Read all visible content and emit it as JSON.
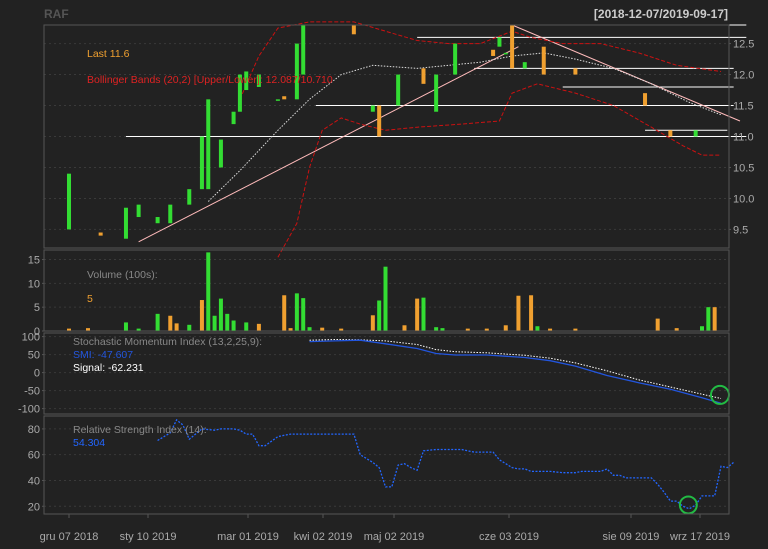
{
  "header": {
    "symbol": "RAF",
    "date_range": "[2018-12-07/2019-09-17]"
  },
  "colors": {
    "background": "#222222",
    "panel_border": "#555555",
    "grid": "#3a3a3a",
    "axis_text": "#aaaaaa",
    "up_candle": "#33dd33",
    "down_candle": "#f0a030",
    "bbands": "#cc1111",
    "bbands_mid": "#dddddd",
    "trendline": "#ffbbbb",
    "hline": "#ffffff",
    "smi": "#2255dd",
    "signal": "#ffffff",
    "rsi": "#2266ff",
    "circle": "#22bb44",
    "last_label": "#f0a030",
    "bb_label": "#dd2222",
    "volume_bar_label": "#f0a030"
  },
  "chart_data": [
    {
      "type": "candlestick",
      "panel": "price",
      "labels": {
        "last": "Last 11.6",
        "bollinger": "Bollinger Bands (20,2) [Upper/Lower]: 12.087/10.710"
      },
      "ylim": [
        9.2,
        12.8
      ],
      "yticks": [
        "9.5",
        "10.0",
        "10.5",
        "11.0",
        "11.5",
        "12.0",
        "12.5"
      ],
      "xticks": [
        "gru 07 2018",
        "sty 10 2019",
        "mar 01 2019",
        "kwi 02 2019",
        "maj 02 2019",
        "cze 03 2019",
        "sie 09 2019",
        "wrz 17 2019"
      ],
      "n": 100,
      "candles": [
        {
          "i": 0,
          "o": 9.5,
          "c": 10.4
        },
        {
          "i": 5,
          "o": 9.45,
          "c": 9.4
        },
        {
          "i": 9,
          "o": 9.35,
          "c": 9.85
        },
        {
          "i": 11,
          "o": 9.7,
          "c": 9.9
        },
        {
          "i": 14,
          "o": 9.6,
          "c": 9.7
        },
        {
          "i": 16,
          "o": 9.6,
          "c": 9.9
        },
        {
          "i": 19,
          "o": 9.9,
          "c": 10.15
        },
        {
          "i": 21,
          "o": 10.15,
          "c": 11.0
        },
        {
          "i": 22,
          "o": 10.15,
          "c": 11.6
        },
        {
          "i": 24,
          "o": 10.5,
          "c": 10.95
        },
        {
          "i": 26,
          "o": 11.2,
          "c": 11.4
        },
        {
          "i": 27,
          "o": 11.4,
          "c": 12.0
        },
        {
          "i": 28,
          "o": 11.75,
          "c": 12.05
        },
        {
          "i": 30,
          "o": 11.8,
          "c": 12.0
        },
        {
          "i": 33,
          "o": 11.6,
          "c": 11.6
        },
        {
          "i": 34,
          "o": 11.65,
          "c": 11.6
        },
        {
          "i": 36,
          "o": 11.6,
          "c": 12.5
        },
        {
          "i": 37,
          "o": 12.0,
          "c": 12.8
        },
        {
          "i": 45,
          "o": 12.8,
          "c": 12.65
        },
        {
          "i": 48,
          "o": 11.4,
          "c": 11.5
        },
        {
          "i": 49,
          "o": 11.5,
          "c": 11.0
        },
        {
          "i": 52,
          "o": 11.5,
          "c": 12.0
        },
        {
          "i": 56,
          "o": 12.1,
          "c": 11.85
        },
        {
          "i": 58,
          "o": 11.4,
          "c": 12.0
        },
        {
          "i": 61,
          "o": 12.0,
          "c": 12.5
        },
        {
          "i": 67,
          "o": 12.4,
          "c": 12.3
        },
        {
          "i": 68,
          "o": 12.45,
          "c": 12.6
        },
        {
          "i": 69,
          "o": 12.35,
          "c": 12.35
        },
        {
          "i": 70,
          "o": 12.8,
          "c": 12.1
        },
        {
          "i": 72,
          "o": 12.1,
          "c": 12.2
        },
        {
          "i": 75,
          "o": 12.45,
          "c": 12.0
        },
        {
          "i": 80,
          "o": 12.1,
          "c": 12.0
        },
        {
          "i": 91,
          "o": 11.7,
          "c": 11.5
        },
        {
          "i": 95,
          "o": 11.1,
          "c": 11.0
        },
        {
          "i": 99,
          "o": 11.0,
          "c": 11.1
        }
      ],
      "bb_upper": [
        [
          27,
          11.6
        ],
        [
          30,
          12.3
        ],
        [
          33,
          12.75
        ],
        [
          38,
          12.85
        ],
        [
          45,
          12.85
        ],
        [
          50,
          12.7
        ],
        [
          55,
          12.55
        ],
        [
          60,
          12.5
        ],
        [
          65,
          12.5
        ],
        [
          70,
          12.7
        ],
        [
          73,
          12.6
        ],
        [
          78,
          12.5
        ],
        [
          84,
          12.5
        ],
        [
          90,
          12.35
        ],
        [
          96,
          12.15
        ],
        [
          103,
          12.05
        ]
      ],
      "bb_mid": [
        [
          22,
          9.95
        ],
        [
          27,
          10.45
        ],
        [
          33,
          11.1
        ],
        [
          38,
          11.6
        ],
        [
          43,
          12.0
        ],
        [
          48,
          12.15
        ],
        [
          55,
          12.1
        ],
        [
          60,
          12.15
        ],
        [
          65,
          12.2
        ],
        [
          70,
          12.3
        ],
        [
          75,
          12.35
        ],
        [
          80,
          12.25
        ],
        [
          86,
          12.1
        ],
        [
          92,
          11.85
        ],
        [
          98,
          11.55
        ],
        [
          103,
          11.35
        ]
      ],
      "bb_lower": [
        [
          33,
          9.05
        ],
        [
          36,
          9.6
        ],
        [
          38,
          10.5
        ],
        [
          40,
          11.1
        ],
        [
          43,
          11.3
        ],
        [
          46,
          11.2
        ],
        [
          50,
          11.1
        ],
        [
          55,
          11.15
        ],
        [
          62,
          11.2
        ],
        [
          68,
          11.25
        ],
        [
          70,
          11.7
        ],
        [
          74,
          11.85
        ],
        [
          80,
          11.7
        ],
        [
          86,
          11.5
        ],
        [
          92,
          11.15
        ],
        [
          97,
          10.85
        ],
        [
          100,
          10.7
        ],
        [
          103,
          10.7
        ]
      ],
      "trendlines": [
        [
          [
            11,
            9.3
          ],
          [
            71,
            12.45
          ]
        ],
        [
          [
            70,
            12.8
          ],
          [
            106,
            11.25
          ]
        ]
      ],
      "hlines": [
        [
          9,
          107,
          11.0
        ],
        [
          31,
          107,
          12.8
        ],
        [
          55,
          107,
          12.6
        ],
        [
          64,
          105,
          12.1
        ],
        [
          39,
          105,
          11.5
        ],
        [
          78,
          105,
          11.8
        ],
        [
          91,
          104,
          11.1
        ]
      ]
    },
    {
      "type": "bar",
      "panel": "volume",
      "label": "Volume (100s):",
      "last_value": "5",
      "ylim": [
        0,
        17
      ],
      "yticks": [
        "0",
        "5",
        "10",
        "15"
      ],
      "bars": [
        {
          "i": 0,
          "v": 0.5,
          "d": 1
        },
        {
          "i": 3,
          "v": 0.6,
          "d": 1
        },
        {
          "i": 9,
          "v": 1.8,
          "d": 0
        },
        {
          "i": 11,
          "v": 0.5,
          "d": 0
        },
        {
          "i": 14,
          "v": 3.6,
          "d": 0
        },
        {
          "i": 16,
          "v": 3.2,
          "d": 1
        },
        {
          "i": 17,
          "v": 1.6,
          "d": 1
        },
        {
          "i": 19,
          "v": 1.3,
          "d": 0
        },
        {
          "i": 21,
          "v": 6.5,
          "d": 1
        },
        {
          "i": 22,
          "v": 16.5,
          "d": 0
        },
        {
          "i": 23,
          "v": 3.2,
          "d": 0
        },
        {
          "i": 24,
          "v": 6.8,
          "d": 0
        },
        {
          "i": 25,
          "v": 3.6,
          "d": 0
        },
        {
          "i": 26,
          "v": 2.2,
          "d": 0
        },
        {
          "i": 28,
          "v": 1.8,
          "d": 0
        },
        {
          "i": 30,
          "v": 1.5,
          "d": 1
        },
        {
          "i": 34,
          "v": 7.5,
          "d": 1
        },
        {
          "i": 35,
          "v": 0.6,
          "d": 1
        },
        {
          "i": 36,
          "v": 7.9,
          "d": 0
        },
        {
          "i": 37,
          "v": 6.9,
          "d": 0
        },
        {
          "i": 38,
          "v": 0.8,
          "d": 0
        },
        {
          "i": 40,
          "v": 0.7,
          "d": 1
        },
        {
          "i": 43,
          "v": 0.5,
          "d": 1
        },
        {
          "i": 48,
          "v": 3.3,
          "d": 1
        },
        {
          "i": 49,
          "v": 6.4,
          "d": 0
        },
        {
          "i": 50,
          "v": 13.5,
          "d": 0
        },
        {
          "i": 53,
          "v": 1.2,
          "d": 1
        },
        {
          "i": 55,
          "v": 6.8,
          "d": 1
        },
        {
          "i": 56,
          "v": 7.0,
          "d": 0
        },
        {
          "i": 58,
          "v": 0.8,
          "d": 0
        },
        {
          "i": 59,
          "v": 0.6,
          "d": 0
        },
        {
          "i": 63,
          "v": 0.5,
          "d": 1
        },
        {
          "i": 66,
          "v": 0.5,
          "d": 1
        },
        {
          "i": 69,
          "v": 1.2,
          "d": 1
        },
        {
          "i": 71,
          "v": 7.4,
          "d": 1
        },
        {
          "i": 73,
          "v": 7.5,
          "d": 1
        },
        {
          "i": 74,
          "v": 1.0,
          "d": 0
        },
        {
          "i": 76,
          "v": 0.5,
          "d": 1
        },
        {
          "i": 80,
          "v": 0.5,
          "d": 1
        },
        {
          "i": 93,
          "v": 2.6,
          "d": 1
        },
        {
          "i": 96,
          "v": 0.6,
          "d": 1
        },
        {
          "i": 100,
          "v": 1.0,
          "d": 0
        },
        {
          "i": 101,
          "v": 5.0,
          "d": 0
        },
        {
          "i": 102,
          "v": 5.0,
          "d": 1
        }
      ]
    },
    {
      "type": "line",
      "panel": "smi",
      "label": "Stochastic Momentum Index (13,2,25,9):",
      "smi_label": "SMI: -47.607",
      "signal_label": "Signal: -62.231",
      "ylim": [
        -115,
        110
      ],
      "yticks": [
        "100",
        "50",
        "0",
        "-50",
        "-100"
      ],
      "smi": [
        [
          38,
          86
        ],
        [
          42,
          88
        ],
        [
          46,
          90
        ],
        [
          50,
          80
        ],
        [
          55,
          67
        ],
        [
          58,
          53
        ],
        [
          61,
          49
        ],
        [
          66,
          49
        ],
        [
          72,
          42
        ],
        [
          76,
          33
        ],
        [
          80,
          18
        ],
        [
          85,
          -8
        ],
        [
          90,
          -28
        ],
        [
          95,
          -46
        ],
        [
          100,
          -70
        ],
        [
          103,
          -85
        ]
      ],
      "signal": [
        [
          38,
          90
        ],
        [
          42,
          92
        ],
        [
          46,
          91
        ],
        [
          50,
          88
        ],
        [
          55,
          78
        ],
        [
          58,
          64
        ],
        [
          61,
          58
        ],
        [
          66,
          55
        ],
        [
          72,
          48
        ],
        [
          76,
          40
        ],
        [
          80,
          27
        ],
        [
          85,
          5
        ],
        [
          90,
          -20
        ],
        [
          95,
          -40
        ],
        [
          100,
          -60
        ],
        [
          103,
          -72
        ]
      ],
      "circle": [
        103,
        -62
      ]
    },
    {
      "type": "line",
      "panel": "rsi",
      "label": "Relative Strength Index (14):",
      "value_label": "54.304",
      "ylim": [
        14,
        90
      ],
      "yticks": [
        "80",
        "60",
        "40",
        "20"
      ],
      "rsi": [
        [
          14,
          71
        ],
        [
          16,
          77
        ],
        [
          17,
          87
        ],
        [
          18,
          83
        ],
        [
          19,
          72
        ],
        [
          21,
          80
        ],
        [
          23,
          79
        ],
        [
          24,
          80
        ],
        [
          26,
          80
        ],
        [
          27,
          79
        ],
        [
          28,
          76
        ],
        [
          29,
          76
        ],
        [
          30,
          67
        ],
        [
          31,
          67
        ],
        [
          33,
          74
        ],
        [
          34,
          75
        ],
        [
          35,
          76
        ],
        [
          38,
          76
        ],
        [
          40,
          76
        ],
        [
          42,
          76
        ],
        [
          44,
          76
        ],
        [
          45,
          76
        ],
        [
          46,
          60
        ],
        [
          48,
          54
        ],
        [
          49,
          50
        ],
        [
          50,
          35
        ],
        [
          51,
          35
        ],
        [
          52,
          52
        ],
        [
          53,
          53
        ],
        [
          54,
          50
        ],
        [
          55,
          48
        ],
        [
          56,
          63
        ],
        [
          58,
          64
        ],
        [
          60,
          64
        ],
        [
          62,
          64
        ],
        [
          64,
          62
        ],
        [
          66,
          62
        ],
        [
          67,
          62
        ],
        [
          68,
          56
        ],
        [
          70,
          50
        ],
        [
          71,
          49
        ],
        [
          72,
          49
        ],
        [
          73,
          47
        ],
        [
          74,
          47
        ],
        [
          75,
          47
        ],
        [
          76,
          47
        ],
        [
          78,
          46
        ],
        [
          80,
          46
        ],
        [
          81,
          47
        ],
        [
          83,
          47
        ],
        [
          84,
          47
        ],
        [
          85,
          49
        ],
        [
          86,
          44
        ],
        [
          87,
          44
        ],
        [
          88,
          42
        ],
        [
          89,
          42
        ],
        [
          90,
          42
        ],
        [
          92,
          42
        ],
        [
          93,
          37
        ],
        [
          94,
          31
        ],
        [
          95,
          24
        ],
        [
          96,
          24
        ],
        [
          97,
          20
        ],
        [
          98,
          18
        ],
        [
          99,
          21
        ],
        [
          100,
          28
        ],
        [
          101,
          28
        ],
        [
          102,
          28
        ],
        [
          103,
          51
        ],
        [
          104,
          50
        ],
        [
          105,
          54
        ]
      ],
      "circle": [
        98,
        21
      ]
    }
  ]
}
